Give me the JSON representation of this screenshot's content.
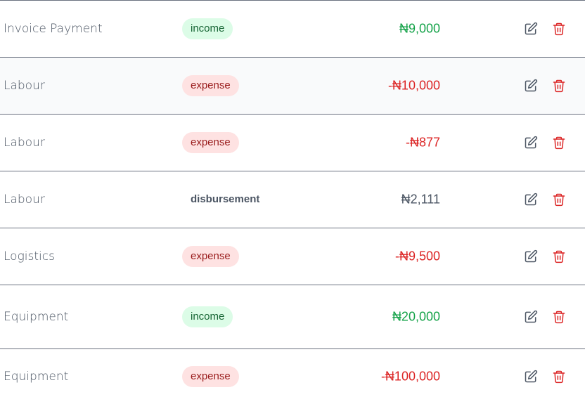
{
  "colors": {
    "income_badge_bg": "#dcfce7",
    "income_badge_text": "#166534",
    "expense_badge_bg": "#fee2e2",
    "expense_badge_text": "#991b1b",
    "income_amount": "#16a34a",
    "expense_amount": "#dc2626",
    "neutral_amount": "#4b5563",
    "edit_icon": "#4b5563",
    "delete_icon": "#dc2626"
  },
  "icons": {
    "edit": "edit-icon",
    "delete": "trash-icon"
  },
  "transactions": [
    {
      "description": "Invoice Payment",
      "type": "income",
      "amount": "₦9,000"
    },
    {
      "description": "Labour",
      "type": "expense",
      "amount": "-₦10,000"
    },
    {
      "description": "Labour",
      "type": "expense",
      "amount": "-₦877"
    },
    {
      "description": "Labour",
      "type": "disbursement",
      "amount": "₦2,111"
    },
    {
      "description": "Logistics",
      "type": "expense",
      "amount": "-₦9,500"
    },
    {
      "description": "Equipment",
      "type": "income",
      "amount": "₦20,000"
    },
    {
      "description": "Equipment",
      "type": "expense",
      "amount": "-₦100,000"
    }
  ]
}
